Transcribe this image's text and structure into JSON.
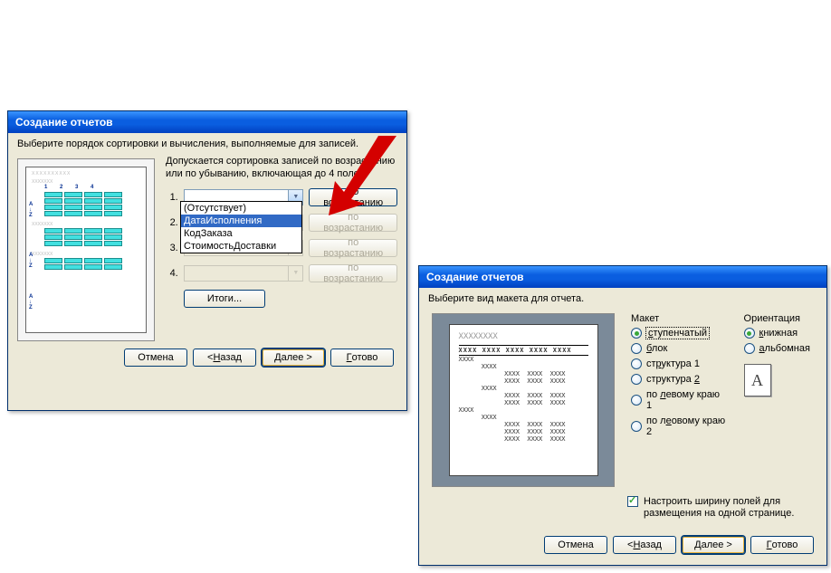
{
  "dialog1": {
    "title": "Создание отчетов",
    "instruction": "Выберите порядок сортировки и вычисления, выполняемые для записей.",
    "sub_instruction": "Допускается сортировка записей по возрастанию или по убыванию, включающая до 4 полей.",
    "sort_labels": [
      "1.",
      "2.",
      "3.",
      "4."
    ],
    "asc_button": "по возрастанию",
    "dropdown_options": [
      "(Отсутствует)",
      "ДатаИсполнения",
      "КодЗаказа",
      "СтоимостьДоставки"
    ],
    "itogi_button": "Итоги...",
    "buttons": {
      "cancel": "Отмена",
      "back_prefix": "< ",
      "back_underline": "Н",
      "back_rest": "азад",
      "next_underline": "Д",
      "next_rest": "алее >",
      "finish_underline": "Г",
      "finish_rest": "отово"
    },
    "preview_nums": "1 2 3 4"
  },
  "dialog2": {
    "title": "Создание отчетов",
    "instruction": "Выберите вид макета для отчета.",
    "layout_group": "Макет",
    "layout_options": {
      "stepped_u": "с",
      "stepped_r": "тупенчатый",
      "block_u": "б",
      "block_r": "лок",
      "struct1_pre": "ст",
      "struct1_u": "р",
      "struct1_post": "уктура 1",
      "struct2_pre": "структура ",
      "struct2_u": "2",
      "left1_pre": "по ",
      "left1_u": "л",
      "left1_post": "евому краю 1",
      "left2_pre": "по л",
      "left2_u": "е",
      "left2_post": "овому краю 2"
    },
    "orient_group": "Ориентация",
    "orient_options": {
      "portrait_u": "к",
      "portrait_r": "нижная",
      "landscape_u": "а",
      "landscape_r": "льбомная"
    },
    "orient_icon_letter": "A",
    "fit_width": "Настроить ширину полей для размещения на одной странице.",
    "preview_title": "XXXXXXXX",
    "preview_header": "XXXX  XXXX  XXXX  XXXX  XXXX",
    "buttons": {
      "cancel": "Отмена",
      "back_prefix": "< ",
      "back_underline": "Н",
      "back_rest": "азад",
      "next_underline": "Д",
      "next_rest": "алее >",
      "finish_underline": "Г",
      "finish_rest": "отово"
    }
  }
}
